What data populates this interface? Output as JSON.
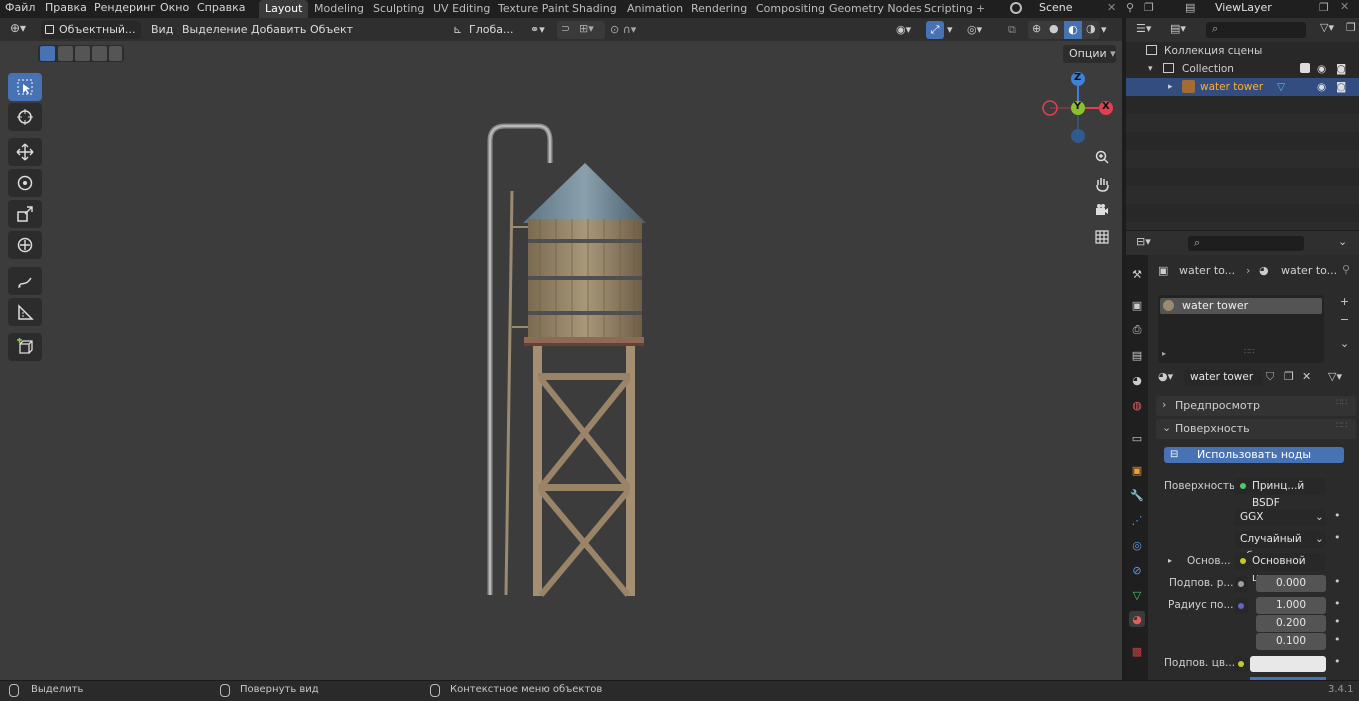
{
  "menu": [
    "Файл",
    "Правка",
    "Рендеринг",
    "Окно",
    "Справка"
  ],
  "workspace_tabs": [
    "Layout",
    "Modeling",
    "Sculpting",
    "UV Editing",
    "Texture Paint",
    "Shading",
    "Animation",
    "Rendering",
    "Compositing",
    "Geometry Nodes",
    "Scripting"
  ],
  "active_tab": "Layout",
  "add_tab": "+",
  "scene_name": "Scene",
  "view_layer": "ViewLayer",
  "viewport_header": {
    "mode": "Объектный...",
    "view": "Вид",
    "select": "Выделение",
    "add": "Добавить",
    "object": "Объект",
    "orientation": "Глоба...",
    "options": "Опции"
  },
  "gizmo": {
    "z": "Z",
    "y": "Y",
    "x": "X"
  },
  "outliner": {
    "scene_collection": "Коллекция сцены",
    "collection": "Collection",
    "object": "water tower"
  },
  "properties": {
    "breadcrumb_object": "water to...",
    "breadcrumb_material": "water to...",
    "material_slot": "water tower",
    "material_name": "water tower",
    "preview_panel": "Предпросмотр",
    "surface_panel": "Поверхность",
    "use_nodes": "Использовать ноды",
    "surface_label": "Поверхность",
    "surface_shader": "Принц...й BSDF",
    "distribution": "GGX",
    "subsurface_method": "Случайный об...",
    "base_label": "Основ...",
    "base_value": "Основной цвет",
    "subsurface_label": "Подпов. р...",
    "subsurface_value": "0.000",
    "radius_label": "Радиус по...",
    "radius_values": [
      "1.000",
      "0.200",
      "0.100"
    ],
    "subsurface_color_label": "Подпов. цв..."
  },
  "status": {
    "select": "Выделить",
    "rotate": "Повернуть вид",
    "context": "Контекстное меню объектов",
    "version": "3.4.1"
  },
  "colors": {
    "accent": "#4772b3",
    "selected_text": "#ffaf29",
    "axis_x": "#e0404f",
    "axis_y": "#8bc12d",
    "axis_z": "#3d82d6"
  }
}
